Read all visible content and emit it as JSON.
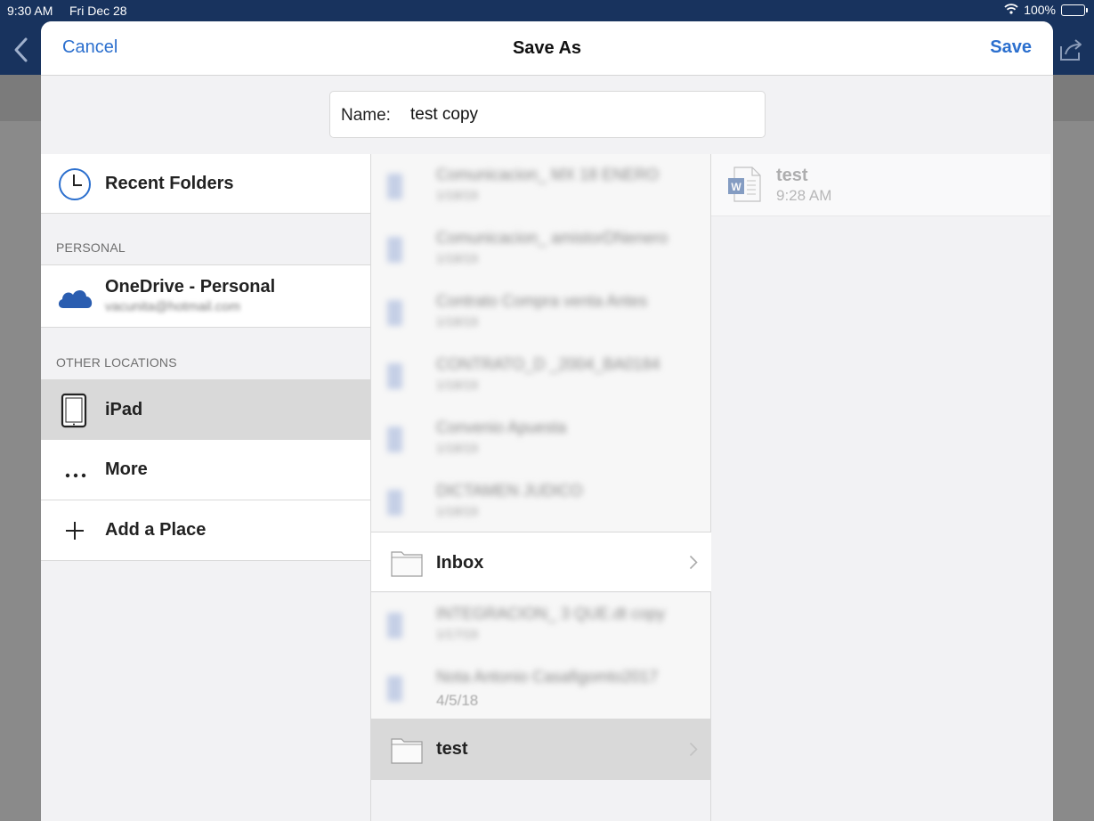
{
  "status_bar": {
    "time": "9:30 AM",
    "date": "Fri Dec 28",
    "battery": "100%"
  },
  "dialog": {
    "title": "Save As",
    "cancel_label": "Cancel",
    "save_label": "Save"
  },
  "name_field": {
    "label": "Name:",
    "value": "test copy"
  },
  "locations": {
    "recent_folders": "Recent Folders",
    "personal_header": "PERSONAL",
    "onedrive": {
      "label": "OneDrive - Personal",
      "account": "vacunita@hotmail.com"
    },
    "other_header": "OTHER LOCATIONS",
    "ipad": "iPad",
    "more": "More",
    "add_place": "Add a Place"
  },
  "files_blurred": [
    {
      "name": "Comunicacion_ MX 18 ENERO",
      "date": "1/18/19"
    },
    {
      "name": "Comunicacion_ amistorDNenero",
      "date": "1/18/19"
    },
    {
      "name": "Contrato Compra venta Antes",
      "date": "1/18/19"
    },
    {
      "name": "CONTRATO_D _2004_BA0184",
      "date": "1/18/19"
    },
    {
      "name": "Convenio Apuesta",
      "date": "1/18/19"
    },
    {
      "name": "DICTAMEN JUDICO",
      "date": "1/18/19"
    },
    {
      "name": "INTEGRACION_ 3 QUE.dt copy",
      "date": "1/17/19"
    },
    {
      "name": "Nota Antonio Casafigomto2017",
      "date": "4/5/18"
    }
  ],
  "folders": {
    "inbox": "Inbox",
    "test": "test"
  },
  "document": {
    "name": "test",
    "time": "9:28 AM"
  },
  "colors": {
    "accent": "#2b6fce",
    "nav_bar": "#18335e",
    "selected_row": "#d9d9d9",
    "onedrive_blue": "#2a5db0"
  }
}
